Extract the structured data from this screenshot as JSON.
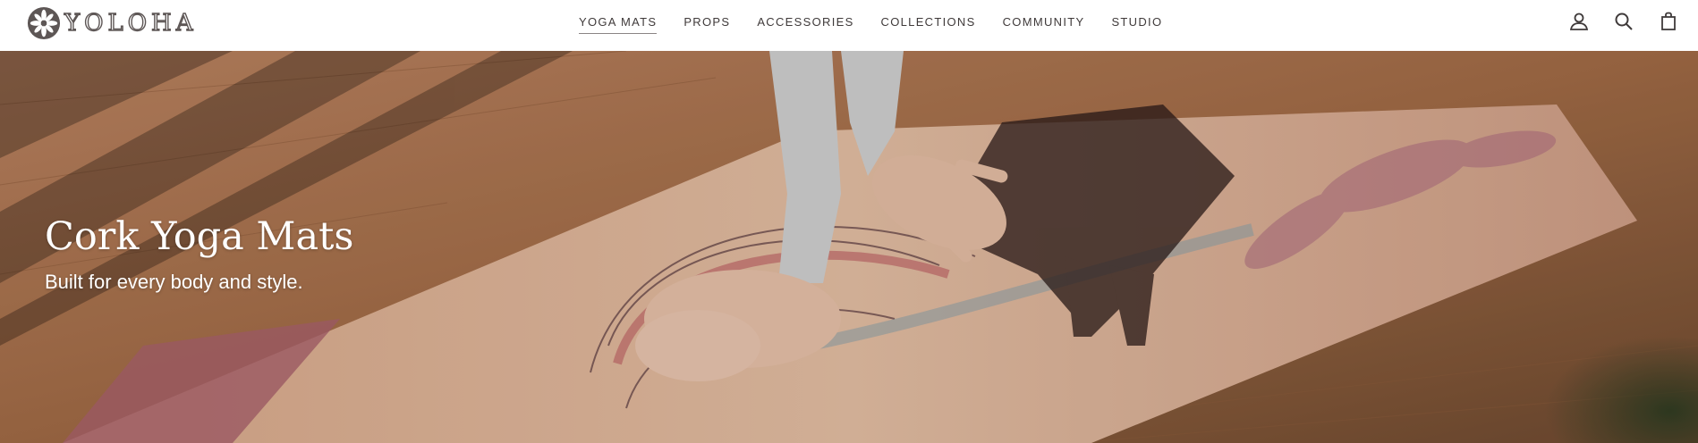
{
  "brand": {
    "name": "YOLOHA"
  },
  "nav": {
    "items": [
      {
        "label": "YOGA MATS",
        "active": true
      },
      {
        "label": "PROPS",
        "active": false
      },
      {
        "label": "ACCESSORIES",
        "active": false
      },
      {
        "label": "COLLECTIONS",
        "active": false
      },
      {
        "label": "COMMUNITY",
        "active": false
      },
      {
        "label": "STUDIO",
        "active": false
      }
    ]
  },
  "header_icons": [
    "account-icon",
    "search-icon",
    "cart-icon"
  ],
  "hero": {
    "title": "Cork Yoga Mats",
    "subtitle": "Built for every body and style."
  },
  "colors": {
    "nav_text": "#3f3a3a",
    "logo": "#5d5655",
    "hero_text": "#ffffff",
    "floor": "#a8704a",
    "mat": "#dcb49a"
  }
}
